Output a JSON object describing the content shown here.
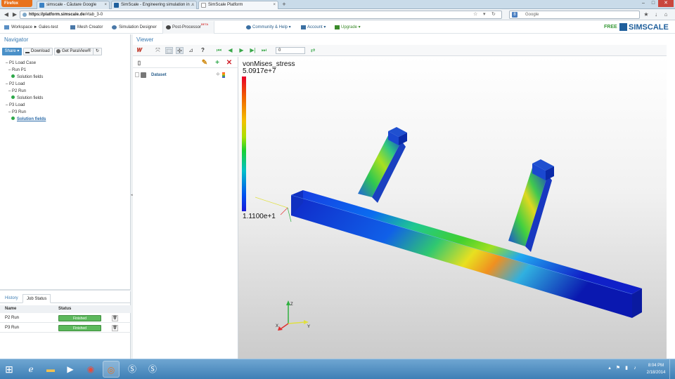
{
  "browser": {
    "menu_label": "Firefox",
    "tabs": [
      {
        "title": "simscale - Căutare Google",
        "favicon_color": "#3b82c4"
      },
      {
        "title": "SimScale - Engineering simulation in ...",
        "favicon_color": "#1f5f9c"
      },
      {
        "title": "SimScale Platform",
        "favicon_color": "#ffffff"
      }
    ],
    "url_host": "https://platform.simscale.de",
    "url_path": "/#tab_3-0",
    "search_placeholder": "Google",
    "search_engine_letter": "8"
  },
  "app": {
    "tabs": [
      {
        "label": "Workspace ► Gales-test"
      },
      {
        "label": "Mesh Creator"
      },
      {
        "label": "Simulation Designer"
      },
      {
        "label": "Post-Processor",
        "badge": "BETA"
      }
    ],
    "menus": {
      "community": "Community & Help",
      "account": "Account",
      "upgrade": "Upgrade"
    },
    "plan": "FREE",
    "logo": "SIMSCALE"
  },
  "navigator": {
    "title": "Navigator",
    "toolbar": {
      "share": "Share",
      "download": "Download",
      "paraview": "Get ParaView®"
    },
    "tree": [
      {
        "label": "P1 Load Case",
        "level": 0
      },
      {
        "label": "Run P1",
        "level": 1
      },
      {
        "label": "Solution fields",
        "level": 2,
        "dot": true
      },
      {
        "label": "P2 Load",
        "level": 0
      },
      {
        "label": "P2 Run",
        "level": 1
      },
      {
        "label": "Solution fields",
        "level": 2,
        "dot": true
      },
      {
        "label": "P3 Load",
        "level": 0
      },
      {
        "label": "P3 Run",
        "level": 1
      },
      {
        "label": "Solution fields",
        "level": 2,
        "dot": true,
        "selected": true
      }
    ]
  },
  "jobs": {
    "tabs": [
      "History",
      "Job Status"
    ],
    "columns": [
      "Name",
      "Status"
    ],
    "rows": [
      {
        "name": "P2 Run",
        "status": "Finished"
      },
      {
        "name": "P3 Run",
        "status": "Finished"
      }
    ]
  },
  "viewer": {
    "title": "Viewer",
    "frame_value": "0",
    "pipeline_item": "Dataset",
    "legend": {
      "field": "vonMises_stress",
      "max": "5.0917e+7",
      "min": "1.1100e+1"
    },
    "axes": {
      "x": "X",
      "y": "Y",
      "z": "Z"
    }
  },
  "taskbar": {
    "time": "8:04 PM",
    "date": "2/18/2014"
  }
}
